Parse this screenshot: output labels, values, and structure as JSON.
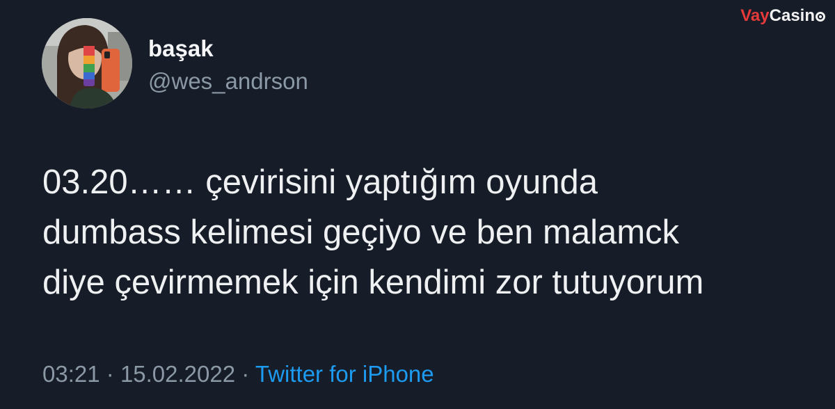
{
  "watermark": {
    "part1": "Vay",
    "part2": "Casin",
    "chip_icon": "poker-chip-icon",
    "part1_color": "#e63a3a"
  },
  "tweet": {
    "avatar_icon": "user-avatar-photo",
    "display_name": "başak",
    "handle": "@wes_andrson",
    "text_lines": [
      "03.20…… çevirisini yaptığım oyunda",
      "dumbass kelimesi geçiyo ve ben malamck",
      "diye çevirmemek için kendimi zor tutuyorum"
    ],
    "time": "03:21",
    "separator": "·",
    "date": "15.02.2022",
    "source": "Twitter for iPhone"
  },
  "colors": {
    "background": "#161c28",
    "text": "#eef0f1",
    "secondary": "#8b98a5",
    "link": "#1d9bf0"
  }
}
